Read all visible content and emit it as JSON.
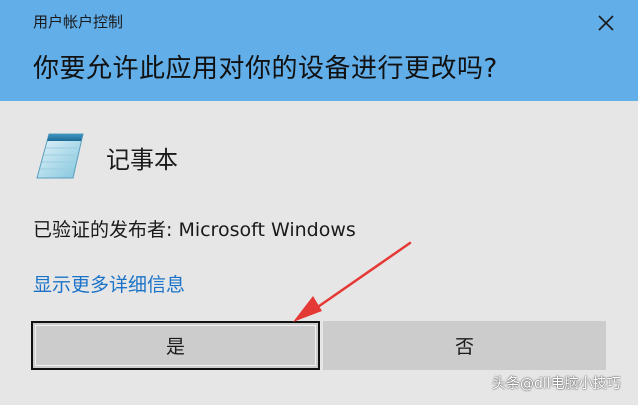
{
  "window": {
    "title": "用户帐户控制",
    "close_icon": "close-icon",
    "header_color": "#62aee9",
    "body_color": "#e6e6e6"
  },
  "prompt": {
    "question": "你要允许此应用对你的设备进行更改吗?"
  },
  "app": {
    "icon": "notepad-icon",
    "name": "记事本"
  },
  "publisher": {
    "text": "已验证的发布者: Microsoft Windows"
  },
  "details_link": {
    "label": "显示更多详细信息",
    "color": "#1a73c9"
  },
  "buttons": {
    "yes_label": "是",
    "no_label": "否"
  },
  "annotation": {
    "arrow_color": "#e53935"
  },
  "watermark": {
    "text": "头条@dll电脑小技巧"
  }
}
